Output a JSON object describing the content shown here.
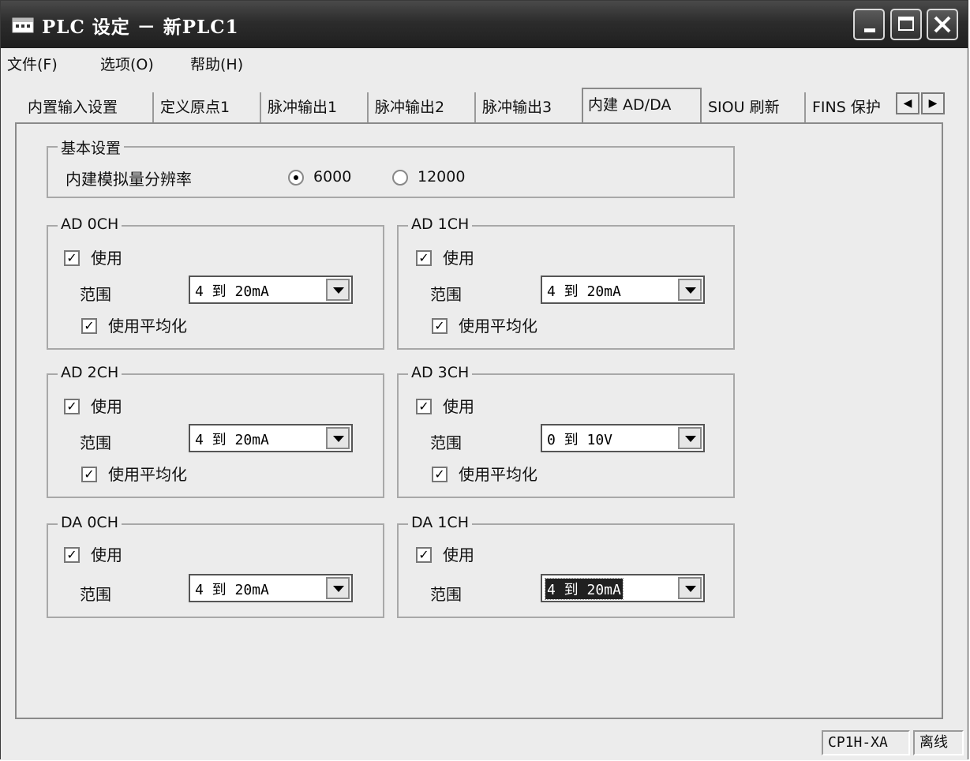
{
  "window": {
    "title": "PLC 设定 － 新PLC1"
  },
  "menu": [
    "文件(F)",
    "选项(O)",
    "帮助(H)"
  ],
  "tabs": [
    {
      "label": "内置输入设置"
    },
    {
      "label": "定义原点1"
    },
    {
      "label": "脉冲输出1"
    },
    {
      "label": "脉冲输出2"
    },
    {
      "label": "脉冲输出3"
    },
    {
      "label": "内建 AD/DA",
      "active": true
    },
    {
      "label": "SIOU 刷新"
    },
    {
      "label": "FINS 保护"
    }
  ],
  "basic": {
    "title": "基本设置",
    "resolution_label": "内建模拟量分辨率",
    "options": [
      {
        "label": "6000",
        "checked": true
      },
      {
        "label": "12000",
        "checked": false
      }
    ]
  },
  "channels": {
    "ad0": {
      "title": "AD 0CH",
      "use_label": "使用",
      "use_checked": true,
      "range_label": "范围",
      "range_value": "4 到 20mA",
      "avg_label": "使用平均化",
      "avg_checked": true
    },
    "ad1": {
      "title": "AD 1CH",
      "use_label": "使用",
      "use_checked": true,
      "range_label": "范围",
      "range_value": "4 到 20mA",
      "avg_label": "使用平均化",
      "avg_checked": true
    },
    "ad2": {
      "title": "AD 2CH",
      "use_label": "使用",
      "use_checked": true,
      "range_label": "范围",
      "range_value": "4 到 20mA",
      "avg_label": "使用平均化",
      "avg_checked": true
    },
    "ad3": {
      "title": "AD 3CH",
      "use_label": "使用",
      "use_checked": true,
      "range_label": "范围",
      "range_value": "0 到 10V",
      "avg_label": "使用平均化",
      "avg_checked": true
    },
    "da0": {
      "title": "DA 0CH",
      "use_label": "使用",
      "use_checked": true,
      "range_label": "范围",
      "range_value": "4 到 20mA"
    },
    "da1": {
      "title": "DA 1CH",
      "use_label": "使用",
      "use_checked": true,
      "range_label": "范围",
      "range_value": "4 到 20mA",
      "focused": true
    }
  },
  "status": {
    "model": "CP1H-XA",
    "mode": "离线"
  }
}
